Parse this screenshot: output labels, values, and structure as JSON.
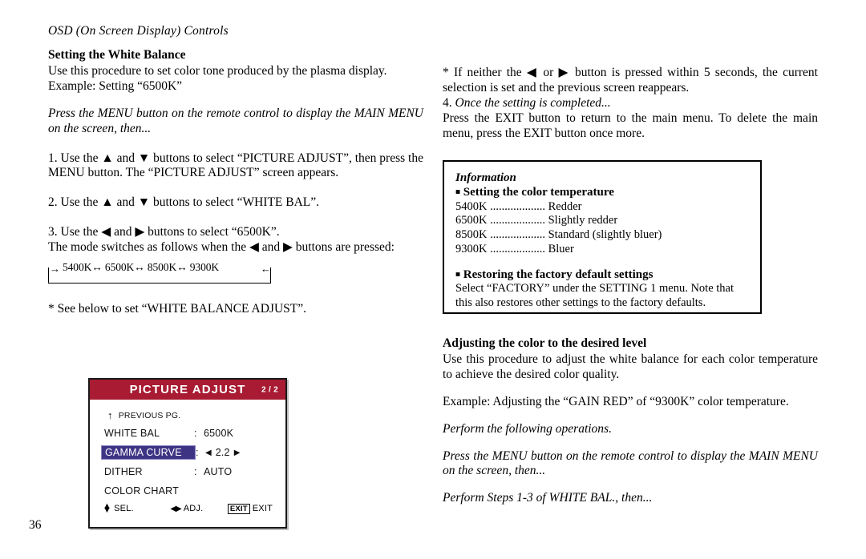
{
  "document": {
    "running_head": "OSD (On Screen Display) Controls",
    "page_number": "36"
  },
  "left_column": {
    "heading": "Setting the White Balance",
    "intro": "Use this procedure to set color tone produced by the plasma display.",
    "example": "Example: Setting “6500K”",
    "menu_instruction": "Press the MENU button on the remote control to display the MAIN MENU on the screen, then...",
    "step1": "1. Use the ▲ and ▼ buttons to select “PICTURE ADJUST”, then press the MENU button. The “PICTURE ADJUST” screen appears.",
    "step2": "2. Use the ▲ and ▼ buttons to select “WHITE BAL”.",
    "step3_a": "3. Use the ◀ and ▶ buttons to select “6500K”.",
    "step3_b": "The mode switches as follows when the ◀ and ▶ buttons are pressed:",
    "cycle_diagram": {
      "sequence": "5400K↔ 6500K↔ 8500K↔ 9300K",
      "arrow_in_left": "→",
      "arrow_in_right": "←",
      "items": [
        "5400K",
        "6500K",
        "8500K",
        "9300K"
      ]
    },
    "see_below": "* See below to set “WHITE BALANCE ADJUST”."
  },
  "osd_panel": {
    "title": "PICTURE ADJUST",
    "page_indicator": "2 / 2",
    "header_color": "#A81B32",
    "highlight_color": "#3E3484",
    "previous_page_label": "PREVIOUS PG.",
    "up_arrow_glyph": "↑",
    "rows": [
      {
        "label": "WHITE BAL",
        "colon": ":",
        "value": "6500K",
        "selected": false,
        "adjustable": false
      },
      {
        "label": "GAMMA CURVE",
        "colon": ":",
        "value": "2.2",
        "selected": true,
        "adjustable": true,
        "left_arrow": "◀",
        "right_arrow": "▶"
      },
      {
        "label": "DITHER",
        "colon": ":",
        "value": "AUTO",
        "selected": false,
        "adjustable": false
      },
      {
        "label": "COLOR CHART",
        "colon": "",
        "value": "",
        "selected": false,
        "adjustable": false
      }
    ],
    "footer": {
      "select_label": "SEL.",
      "adjust_label": "ADJ.",
      "exit_key": "EXIT",
      "exit_label": "EXIT",
      "up_glyph": "▲",
      "down_glyph": "▼",
      "left_glyph": "◀",
      "right_glyph": "▶"
    }
  },
  "right_column": {
    "note_timeout": "* If neither the ◀ or ▶ button is pressed within 5 seconds, the current selection is set and the previous screen reappears.",
    "step4_number": "4.",
    "step4_title": "Once the setting is completed...",
    "step4_body": "Press the EXIT button to return to the main menu. To delete the main menu, press the EXIT button once more.",
    "heading2": "Adjusting the color to the desired level",
    "heading2_body": "Use this procedure to adjust the white balance for each color temperature to achieve the desired color quality.",
    "example2": "Example: Adjusting the “GAIN RED” of “9300K” color temperature.",
    "perform_ops": "Perform the following operations.",
    "menu_instruction2": "Press the MENU button on the remote control to display the MAIN MENU on the screen, then...",
    "perform_steps": "Perform Steps 1-3 of WHITE BAL., then..."
  },
  "information_box": {
    "title": "Information",
    "section1_heading": "Setting the color temperature",
    "bullet_glyph": "■",
    "temperature_rows": [
      {
        "temp": "5400K",
        "leader": " ................... ",
        "desc": "Redder"
      },
      {
        "temp": "6500K",
        "leader": " ................... ",
        "desc": "Slightly redder"
      },
      {
        "temp": "8500K",
        "leader": " ................... ",
        "desc": "Standard (slightly bluer)"
      },
      {
        "temp": "9300K",
        "leader": " ................... ",
        "desc": "Bluer"
      }
    ],
    "section2_heading": "Restoring the factory default settings",
    "section2_body": "Select “FACTORY” under the SETTING 1 menu. Note that this also restores other settings to the factory defaults."
  }
}
